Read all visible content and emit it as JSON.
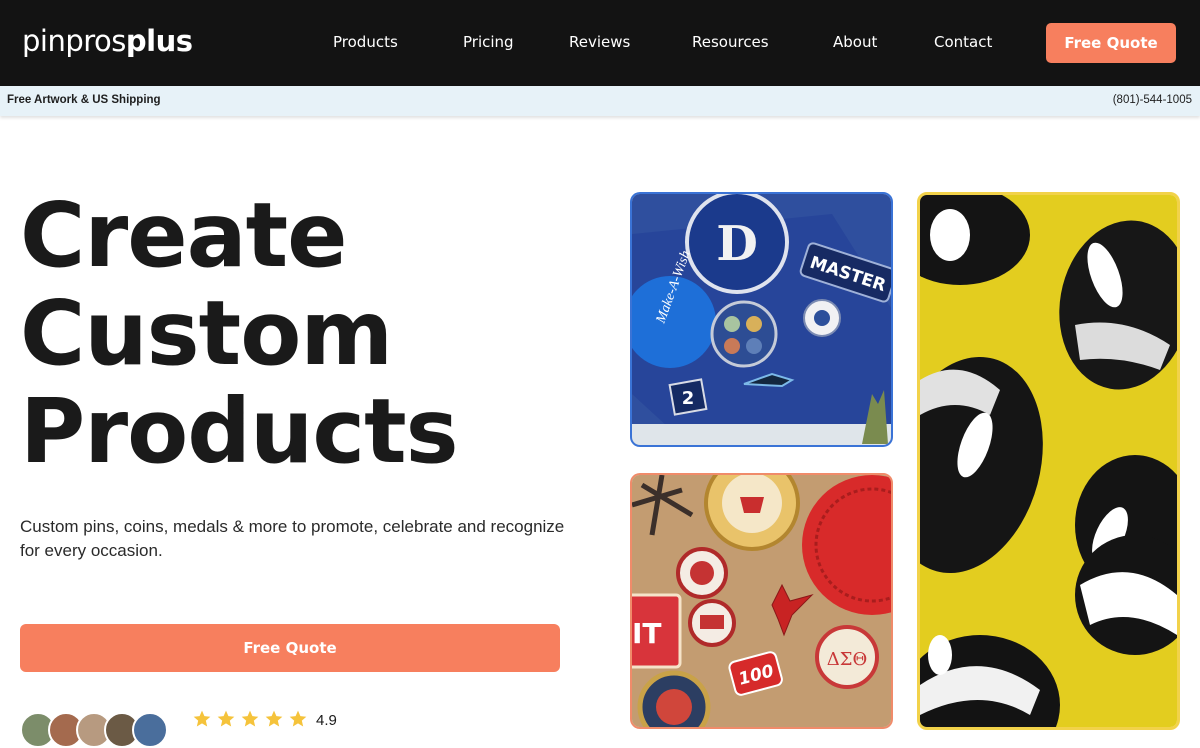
{
  "logo": {
    "part1": "pinpros",
    "part2": "plus"
  },
  "nav": {
    "items": [
      {
        "label": "Products"
      },
      {
        "label": "Pricing"
      },
      {
        "label": "Reviews"
      },
      {
        "label": "Resources"
      },
      {
        "label": "About"
      },
      {
        "label": "Contact"
      }
    ],
    "cta_label": "Free Quote"
  },
  "strip": {
    "left_text": "Free Artwork & US Shipping",
    "phone": "(801)-544-1005"
  },
  "hero": {
    "title_lines": [
      "Create",
      "Custom",
      "Products"
    ],
    "subtitle": "Custom pins, coins, medals & more to promote, celebrate and recognize for every occasion.",
    "cta_label": "Free Quote",
    "rating": "4.9",
    "star_count": 5
  },
  "colors": {
    "header_bg": "#131313",
    "accent": "#f77f5e",
    "strip_bg": "#e7f2f8",
    "star": "#f5c33b"
  },
  "tiles": {
    "blue": {
      "badge_letter": "D",
      "patch_text": "MASTER",
      "coin_text": "Make-A-Wish",
      "pin_number": "2"
    },
    "orange": {
      "patch_text": "IT",
      "pin_number": "100",
      "greek": "ΔΣΘ"
    }
  }
}
